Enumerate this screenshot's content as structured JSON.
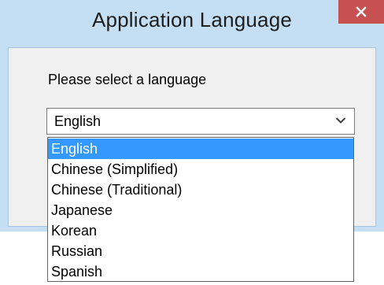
{
  "window": {
    "title": "Application Language",
    "close_icon": "close-icon"
  },
  "dialog": {
    "prompt": "Please select a language",
    "language_select": {
      "selected_value": "English",
      "arrow_icon": "chevron-down-icon",
      "options": [
        {
          "label": "English",
          "highlighted": true
        },
        {
          "label": "Chinese (Simplified)",
          "highlighted": false
        },
        {
          "label": "Chinese (Traditional)",
          "highlighted": false
        },
        {
          "label": "Japanese",
          "highlighted": false
        },
        {
          "label": "Korean",
          "highlighted": false
        },
        {
          "label": "Russian",
          "highlighted": false
        },
        {
          "label": "Spanish",
          "highlighted": false
        }
      ]
    }
  },
  "colors": {
    "title_bar": "#c4dff4",
    "close_button": "#c75050",
    "highlight": "#3399ff"
  }
}
